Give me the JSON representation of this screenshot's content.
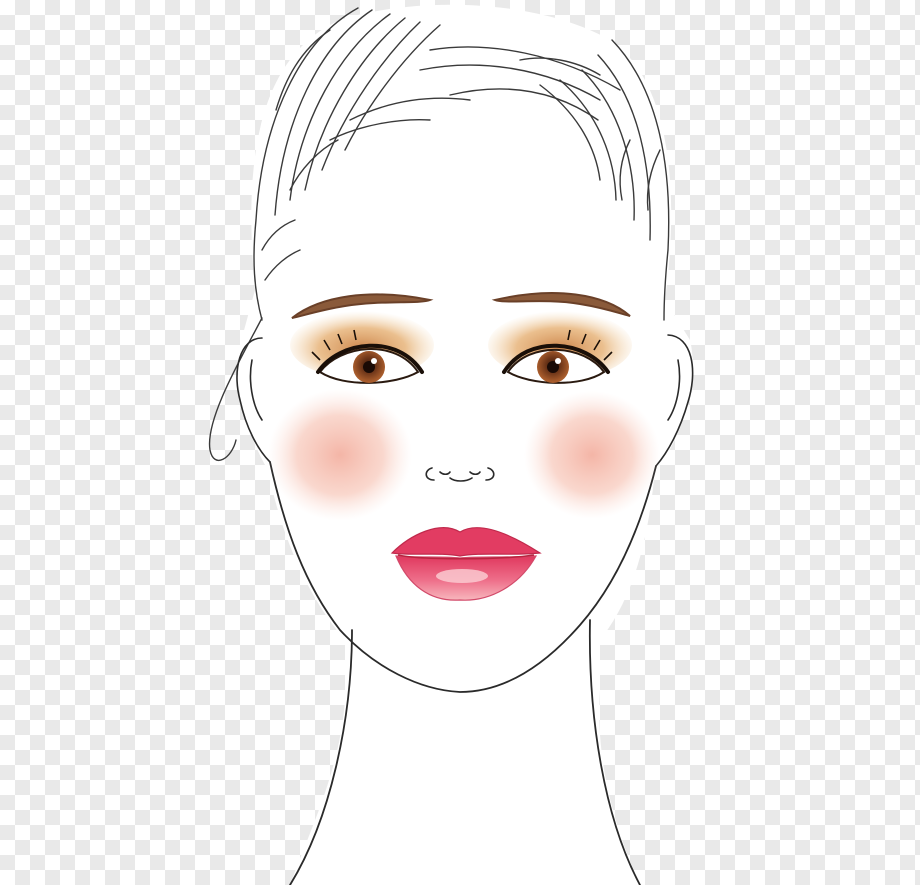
{
  "image": {
    "subject": "fashion-illustration-face",
    "background_pattern": "checkerboard-transparency",
    "colors": {
      "checker_dark": "#e9e9e9",
      "checker_light": "#ffffff",
      "skin": "#ffffff",
      "line": "#2a2a2a",
      "hair_line": "#3a3a3a",
      "brow": "#8a5a3a",
      "eyeshadow": "#d9954a",
      "iris": "#8a4a25",
      "blush": "#f2a897",
      "lips": "#e8486a",
      "lips_highlight": "#f7b3b8"
    }
  }
}
